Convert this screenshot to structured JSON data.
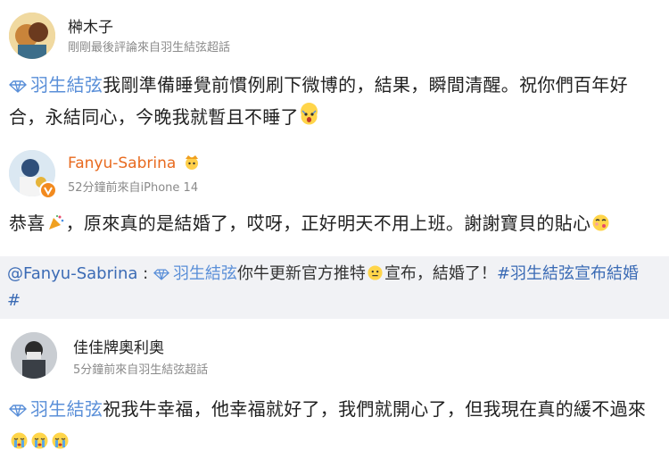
{
  "post1": {
    "username": "榊木子",
    "meta": "剛剛最後評論來自羽生結弦超話",
    "topic": "羽生結弦",
    "text": "我剛準備睡覺前慣例刷下微博的，結果，瞬間清醒。祝你們百年好合，永結同心，今晚我就暫且不睡了",
    "emoji": "shocked-face"
  },
  "post2": {
    "username": "Fanyu-Sabrina",
    "meta": "52分鐘前來自iPhone 14",
    "text_a": "恭喜",
    "text_b": "，原來真的是結婚了，哎呀，正好明天不用上班。謝謝寶貝的貼心",
    "emoji_1": "party-popper",
    "emoji_2": "kissing-face"
  },
  "repost": {
    "mention": "@Fanyu-Sabrina",
    "separator": " : ",
    "topic": "羽生結弦",
    "text_a": "你牛更新官方推特",
    "text_b": "宣布，結婚了！",
    "hashtag_a": "#羽生結弦宣布結婚",
    "hashtag_b": "#",
    "emoji": "thinking-face"
  },
  "post3": {
    "username": "佳佳牌奧利奧",
    "meta": "5分鐘前來自羽生結弦超話",
    "topic": "羽生結弦",
    "text": "祝我牛幸福，他幸福就好了，我們就開心了，但我現在真的緩不過來",
    "emoji": "crying-face"
  },
  "colors": {
    "topic_blue": "#5a8fd8",
    "username_orange": "#e86a1f",
    "repost_bg": "#f1f2f5",
    "meta_gray": "#8a8a8a"
  }
}
